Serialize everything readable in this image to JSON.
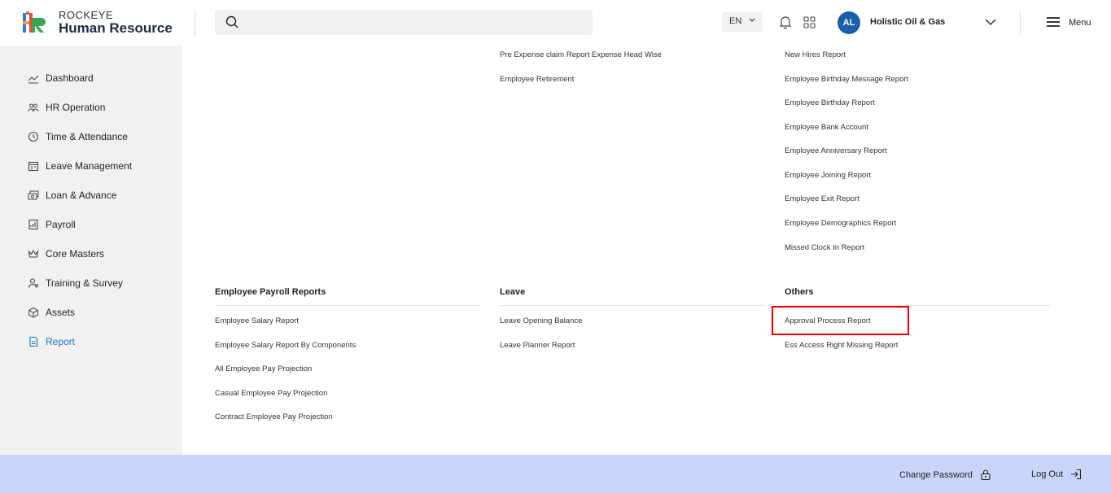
{
  "header": {
    "brand_top": "ROCKEYE",
    "brand_main": "Human Resource",
    "search": {
      "placeholder": ""
    },
    "language": "EN",
    "user_initials": "AL",
    "company_name": "Holistic Oil & Gas",
    "menu_label": "Menu"
  },
  "sidebar": {
    "items": [
      {
        "label": "Dashboard",
        "icon": "chart-line-icon"
      },
      {
        "label": "HR Operation",
        "icon": "people-icon"
      },
      {
        "label": "Time & Attendance",
        "icon": "clock-history-icon"
      },
      {
        "label": "Leave Management",
        "icon": "calendar-icon"
      },
      {
        "label": "Loan & Advance",
        "icon": "money-stack-icon"
      },
      {
        "label": "Payroll",
        "icon": "payroll-icon"
      },
      {
        "label": "Core Masters",
        "icon": "crown-icon"
      },
      {
        "label": "Training & Survey",
        "icon": "user-training-icon"
      },
      {
        "label": "Assets",
        "icon": "box-icon"
      },
      {
        "label": "Report",
        "icon": "document-icon",
        "active": true
      }
    ],
    "active_color": "#1a73c7"
  },
  "main": {
    "col2_top_links": [
      "Pre Expense claim Report Expense Head Wise",
      "Employee Retirement"
    ],
    "col3_top_links": [
      "New Hires Report",
      "Employee Birthday Message Report",
      "Employee Birthday Report",
      "Employee Bank Account",
      "Employee Anniversary Report",
      "Employee Joining Report",
      "Employee Exit Report",
      "Employee Demographics Report",
      "Missed Clock In Report"
    ],
    "sections": [
      {
        "title": "Employee Payroll Reports",
        "links": [
          "Employee Salary Report",
          "Employee Salary Report By Components",
          "All Employee Pay Projection",
          "Casual Employee Pay Projection",
          "Contract Employee Pay Projection"
        ]
      },
      {
        "title": "Leave",
        "links": [
          "Leave Opening Balance",
          "Leave Planner Report"
        ]
      },
      {
        "title": "Others",
        "links": [
          "Approval Process Report",
          "Ess Access Right Missing Report"
        ]
      }
    ],
    "highlight_color": "#ee0000"
  },
  "footer": {
    "change_password": "Change Password",
    "logout": "Log Out",
    "background": "#c9d5fb"
  }
}
